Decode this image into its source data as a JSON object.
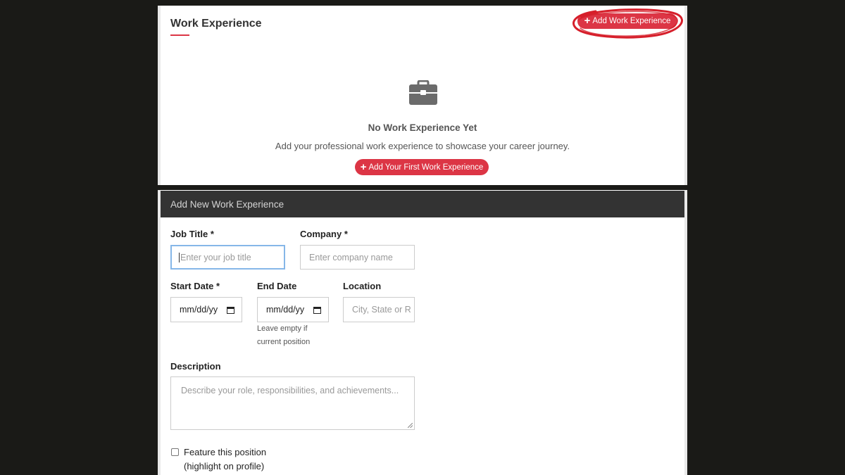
{
  "section": {
    "title": "Work Experience",
    "add_button_label": "Add Work Experience"
  },
  "empty_state": {
    "icon": "briefcase-icon",
    "title": "No Work Experience Yet",
    "description": "Add your professional work experience to showcase your career journey.",
    "button_label": "Add Your First Work Experience"
  },
  "form": {
    "header": "Add New Work Experience",
    "job_title": {
      "label": "Job Title *",
      "placeholder": "Enter your job title"
    },
    "company": {
      "label": "Company *",
      "placeholder": "Enter company name"
    },
    "start_date": {
      "label": "Start Date *",
      "value": "mm/dd/yy"
    },
    "end_date": {
      "label": "End Date",
      "value": "mm/dd/yy",
      "hint_line1": "Leave empty if",
      "hint_line2": "current position"
    },
    "location": {
      "label": "Location",
      "placeholder": "City, State or R"
    },
    "description": {
      "label": "Description",
      "placeholder": "Describe your role, responsibilities, and achievements..."
    },
    "feature": {
      "label_line1": "Feature this position",
      "label_line2": "(highlight on profile)",
      "checked": false
    }
  },
  "colors": {
    "accent": "#dc3545",
    "form_header_bg": "#333333",
    "page_bg": "#1a1a17",
    "annotation": "#d61f2b"
  }
}
